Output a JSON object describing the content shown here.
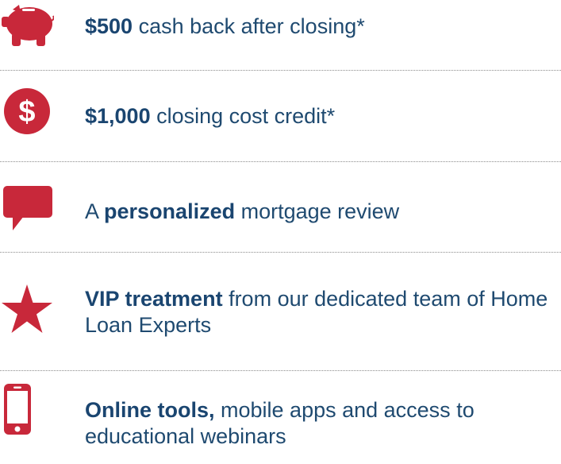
{
  "benefits": [
    {
      "icon": "piggy-bank-icon",
      "bold": "$500",
      "rest": " cash back after closing*"
    },
    {
      "icon": "dollar-icon",
      "bold": "$1,000",
      "rest": " closing cost credit*"
    },
    {
      "icon": "speech-bubble-icon",
      "prefix": "A ",
      "bold": "personalized",
      "rest": " mortgage review"
    },
    {
      "icon": "star-icon",
      "bold": "VIP treatment",
      "rest": " from our dedicated team of Home Loan Experts"
    },
    {
      "icon": "smartphone-icon",
      "bold": "Online tools,",
      "rest": " mobile apps and access to educational webinars"
    }
  ],
  "colors": {
    "icon_red": "#c8283a",
    "text_navy": "#1f4a70",
    "divider_gray": "#8c8c8c"
  }
}
